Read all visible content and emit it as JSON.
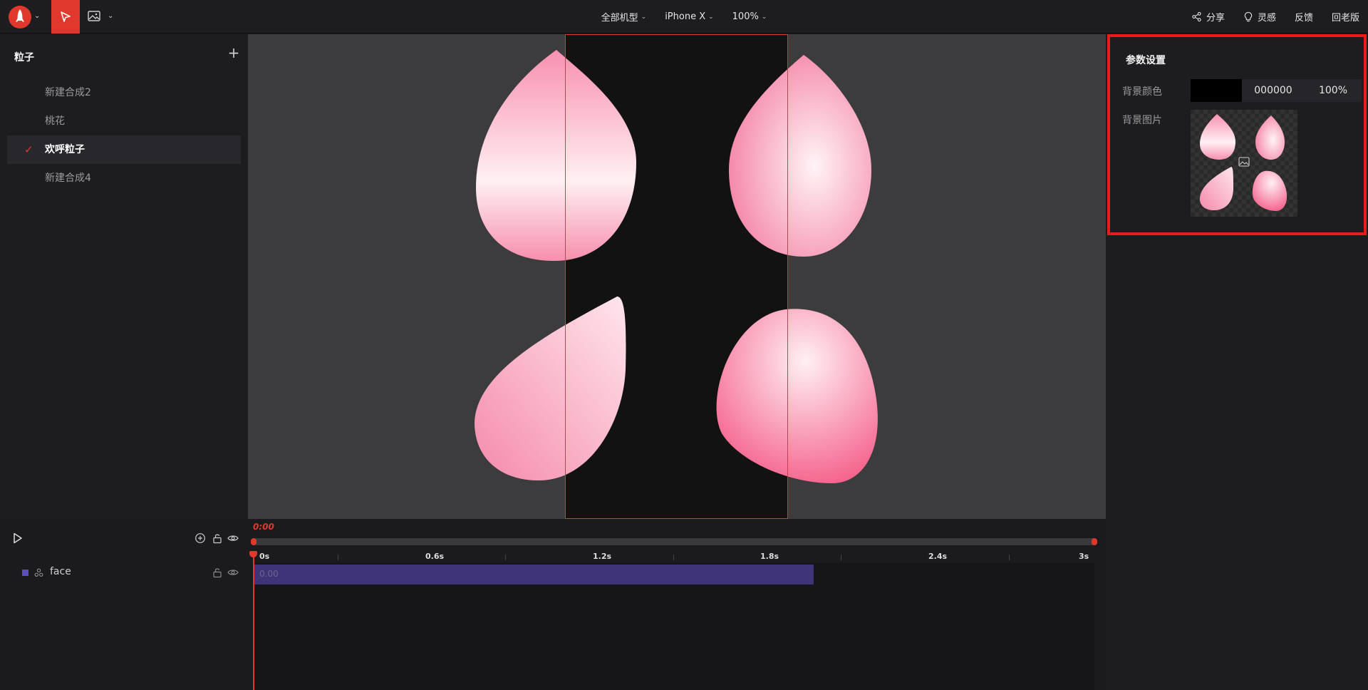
{
  "topbar": {
    "device_group": "全部机型",
    "device": "iPhone X",
    "zoom": "100%",
    "share": "分享",
    "inspiration": "灵感",
    "feedback": "反馈",
    "old_version": "回老版"
  },
  "left_panel": {
    "title": "粒子",
    "items": [
      {
        "label": "新建合成2",
        "active": false
      },
      {
        "label": "桃花",
        "active": false
      },
      {
        "label": "欢呼粒子",
        "active": true
      },
      {
        "label": "新建合成4",
        "active": false
      }
    ]
  },
  "right_panel": {
    "title": "参数设置",
    "bg_color_label": "背景颜色",
    "bg_color_hex": "000000",
    "bg_color_alpha": "100%",
    "bg_image_label": "背景图片"
  },
  "timeline": {
    "current_time": "0:00",
    "ticks": [
      "0s",
      "0.6s",
      "1.2s",
      "1.8s",
      "2.4s",
      "3s"
    ],
    "layer_name": "face",
    "track_value": "0.00"
  },
  "colors": {
    "accent": "#e0382c",
    "layer": "#5b4fc0",
    "track": "#3f3478"
  }
}
